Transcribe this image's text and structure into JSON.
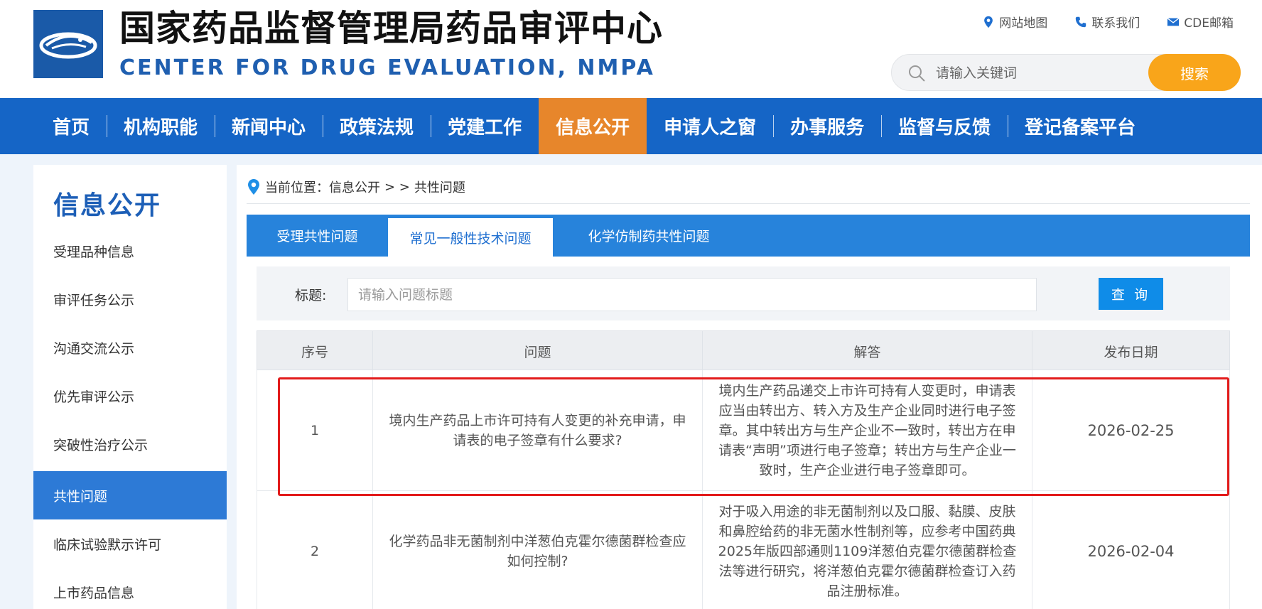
{
  "header": {
    "title_cn": "国家药品监督管理局药品审评中心",
    "title_en": "CENTER FOR DRUG EVALUATION, NMPA",
    "links": [
      {
        "label": "网站地图",
        "icon": "location-pin-icon"
      },
      {
        "label": "联系我们",
        "icon": "phone-icon"
      },
      {
        "label": "CDE邮箱",
        "icon": "mail-icon"
      }
    ],
    "search_placeholder": "请输入关键词",
    "search_button": "搜索"
  },
  "nav": {
    "items": [
      "首页",
      "机构职能",
      "新闻中心",
      "政策法规",
      "党建工作",
      "信息公开",
      "申请人之窗",
      "办事服务",
      "监督与反馈",
      "登记备案平台"
    ],
    "active": "信息公开"
  },
  "sidebar": {
    "title": "信息公开",
    "items": [
      "受理品种信息",
      "审评任务公示",
      "沟通交流公示",
      "优先审评公示",
      "突破性治疗公示",
      "共性问题",
      "临床试验默示许可",
      "上市药品信息"
    ],
    "active": "共性问题"
  },
  "breadcrumb": {
    "prefix": "当前位置：信息公开",
    "sep": "> >",
    "current": "共性问题"
  },
  "tabs": {
    "items": [
      "受理共性问题",
      "常见一般性技术问题",
      "化学仿制药共性问题"
    ],
    "active": "常见一般性技术问题"
  },
  "filter": {
    "label": "标题:",
    "placeholder": "请输入问题标题",
    "button": "查 询"
  },
  "table": {
    "headers": [
      "序号",
      "问题",
      "解答",
      "发布日期"
    ],
    "rows": [
      {
        "no": "1",
        "question": "境内生产药品上市许可持有人变更的补充申请，申请表的电子签章有什么要求?",
        "answer": "境内生产药品递交上市许可持有人变更时，申请表应当由转出方、转入方及生产企业同时进行电子签章。其中转出方与生产企业不一致时，转出方在申请表“声明”项进行电子签章；转出方与生产企业一致时，生产企业进行电子签章即可。",
        "date": "2026-02-25"
      },
      {
        "no": "2",
        "question": "化学药品非无菌制剂中洋葱伯克霍尔德菌群检查应如何控制?",
        "answer": "对于吸入用途的非无菌制剂以及口服、黏膜、皮肤和鼻腔给药的非无菌水性制剂等，应参考中国药典2025年版四部通则1109洋葱伯克霍尔德菌群检查法等进行研究，将洋葱伯克霍尔德菌群检查订入药品注册标准。",
        "date": "2026-02-04"
      }
    ]
  },
  "colors": {
    "primary": "#1565c6",
    "nav_active": "#e7862b",
    "search_button": "#f9a51a",
    "query_button": "#0f8ce8",
    "highlight": "#e21b1b"
  }
}
